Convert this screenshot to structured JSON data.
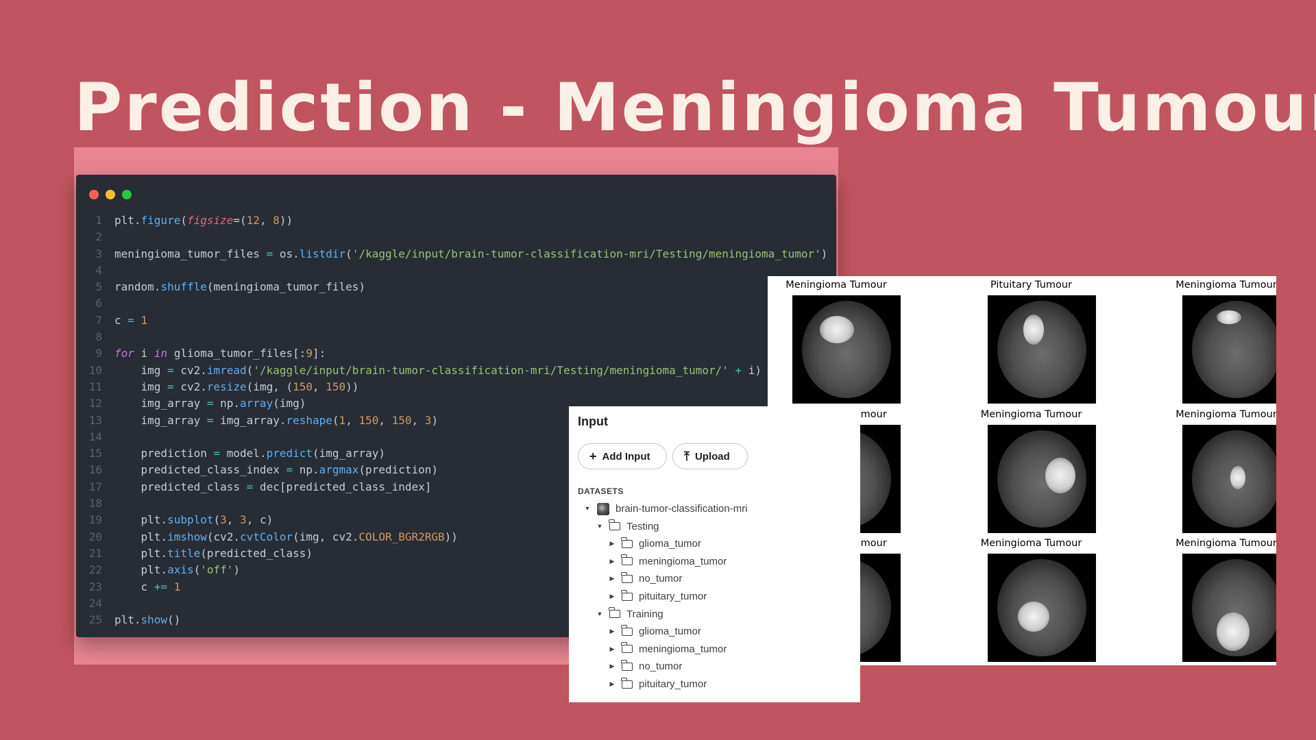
{
  "slide": {
    "title": "Prediction - Meningioma Tumour"
  },
  "code": {
    "lines": [
      {
        "n": "1",
        "html": "plt.<span class=\"t-fn\">figure</span>(<span class=\"t-arg\">figsize</span>=(<span class=\"t-num\">12</span>, <span class=\"t-num\">8</span>))"
      },
      {
        "n": "2",
        "html": ""
      },
      {
        "n": "3",
        "html": "meningioma_tumor_files <span class=\"t-op\">=</span> os.<span class=\"t-fn\">listdir</span>(<span class=\"t-str\">'/kaggle/input/brain-tumor-classification-mri/Testing/meningioma_tumor'</span>)"
      },
      {
        "n": "4",
        "html": ""
      },
      {
        "n": "5",
        "html": "random.<span class=\"t-fn\">shuffle</span>(meningioma_tumor_files)"
      },
      {
        "n": "6",
        "html": ""
      },
      {
        "n": "7",
        "html": "c <span class=\"t-op\">=</span> <span class=\"t-num\">1</span>"
      },
      {
        "n": "8",
        "html": ""
      },
      {
        "n": "9",
        "html": "<span class=\"t-kw\">for</span> i <span class=\"t-kw\">in</span> glioma_tumor_files[:<span class=\"t-num\">9</span>]:"
      },
      {
        "n": "10",
        "html": "    img <span class=\"t-op\">=</span> cv2.<span class=\"t-fn\">imread</span>(<span class=\"t-str\">'/kaggle/input/brain-tumor-classification-mri/Testing/meningioma_tumor/'</span> <span class=\"t-op\">+</span> i)"
      },
      {
        "n": "11",
        "html": "    img <span class=\"t-op\">=</span> cv2.<span class=\"t-fn\">resize</span>(img, (<span class=\"t-num\">150</span>, <span class=\"t-num\">150</span>))"
      },
      {
        "n": "12",
        "html": "    img_array <span class=\"t-op\">=</span> np.<span class=\"t-fn\">array</span>(img)"
      },
      {
        "n": "13",
        "html": "    img_array <span class=\"t-op\">=</span> img_array.<span class=\"t-fn\">reshape</span>(<span class=\"t-num\">1</span>, <span class=\"t-num\">150</span>, <span class=\"t-num\">150</span>, <span class=\"t-num\">3</span>)"
      },
      {
        "n": "14",
        "html": ""
      },
      {
        "n": "15",
        "html": "    prediction <span class=\"t-op\">=</span> model.<span class=\"t-fn\">predict</span>(img_array)"
      },
      {
        "n": "16",
        "html": "    predicted_class_index <span class=\"t-op\">=</span> np.<span class=\"t-fn\">argmax</span>(prediction)"
      },
      {
        "n": "17",
        "html": "    predicted_class <span class=\"t-op\">=</span> dec[predicted_class_index]"
      },
      {
        "n": "18",
        "html": ""
      },
      {
        "n": "19",
        "html": "    plt.<span class=\"t-fn\">subplot</span>(<span class=\"t-num\">3</span>, <span class=\"t-num\">3</span>, c)"
      },
      {
        "n": "20",
        "html": "    plt.<span class=\"t-fn\">imshow</span>(cv2.<span class=\"t-fn\">cvtColor</span>(img, cv2.<span class=\"t-const\">COLOR_BGR2RGB</span>))"
      },
      {
        "n": "21",
        "html": "    plt.<span class=\"t-fn\">title</span>(predicted_class)"
      },
      {
        "n": "22",
        "html": "    plt.<span class=\"t-fn\">axis</span>(<span class=\"t-str\">'off'</span>)"
      },
      {
        "n": "23",
        "html": "    c <span class=\"t-op\">+=</span> <span class=\"t-num\">1</span>"
      },
      {
        "n": "24",
        "html": ""
      },
      {
        "n": "25",
        "html": "plt.<span class=\"t-fn\">show</span>()"
      }
    ]
  },
  "input_panel": {
    "title": "Input",
    "add_input_label": "Add Input",
    "upload_label": "Upload",
    "datasets_label": "DATASETS",
    "tree": [
      {
        "label": "brain-tumor-classification-mri",
        "level": 0,
        "type": "dataset",
        "expanded": true
      },
      {
        "label": "Testing",
        "level": 1,
        "type": "folder",
        "expanded": true
      },
      {
        "label": "glioma_tumor",
        "level": 2,
        "type": "folder",
        "expanded": false
      },
      {
        "label": "meningioma_tumor",
        "level": 2,
        "type": "folder",
        "expanded": false
      },
      {
        "label": "no_tumor",
        "level": 2,
        "type": "folder",
        "expanded": false
      },
      {
        "label": "pituitary_tumor",
        "level": 2,
        "type": "folder",
        "expanded": false
      },
      {
        "label": "Training",
        "level": 1,
        "type": "folder",
        "expanded": true
      },
      {
        "label": "glioma_tumor",
        "level": 2,
        "type": "folder",
        "expanded": false
      },
      {
        "label": "meningioma_tumor",
        "level": 2,
        "type": "folder",
        "expanded": false
      },
      {
        "label": "no_tumor",
        "level": 2,
        "type": "folder",
        "expanded": false
      },
      {
        "label": "pituitary_tumor",
        "level": 2,
        "type": "folder",
        "expanded": false
      }
    ]
  },
  "predictions": [
    {
      "title": "Meningioma Tumour"
    },
    {
      "title": "Pituitary Tumour"
    },
    {
      "title": "Meningioma Tumour"
    },
    {
      "title": "Meningioma Tumour"
    },
    {
      "title": "Meningioma Tumour"
    },
    {
      "title": "Meningioma Tumour"
    },
    {
      "title": "Meningioma Tumour"
    },
    {
      "title": "Meningioma Tumour"
    },
    {
      "title": "Meningioma Tumour"
    }
  ],
  "colors": {
    "background": "#c0545f",
    "code_backdrop": "#e98590",
    "code_window": "#272c35",
    "title_text": "#fbf0e6"
  }
}
